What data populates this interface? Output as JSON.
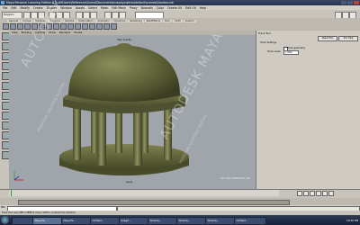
{
  "window": {
    "title": "Maya Personal Learning Edition 8.5: C:\\Users\\Reference\\Guest\\Documents\\maya\\projects\\default\\scenes\\Gazebo.mb"
  },
  "menubar": [
    "File",
    "Edit",
    "Modify",
    "Create",
    "Display",
    "Window",
    "Assets",
    "Select",
    "Mesh",
    "Edit Mesh",
    "Proxy",
    "Normals",
    "Color",
    "Create UV",
    "Edit UV",
    "Help"
  ],
  "statusline": {
    "mode_label": "Polygons"
  },
  "shelf": {
    "tabs": [
      "General",
      "Curves",
      "Surfaces",
      "Polygons",
      "Subdivs",
      "Deformation",
      "Animation",
      "Dynamics",
      "Rendering",
      "PaintEffects",
      "Toon",
      "Cloth",
      "Custom"
    ]
  },
  "viewport": {
    "menu": [
      "View",
      "Shading",
      "Lighting",
      "Show",
      "Renderer",
      "Panels"
    ],
    "panel_label": "High Quality",
    "camera_label": "persp",
    "watermark_1": "AUTODESK MAYA",
    "watermark_2": "AUTODESK MAYA",
    "watermark_small_1": "PERSONAL LEARNING EDITION",
    "watermark_small_2": "PERSONAL LEARNING EDITION",
    "nfc_text": "NOT FOR COMMERCIAL USE"
  },
  "attribute_panel": {
    "header": "Track Tool",
    "reset_button": "Reset Tool",
    "help_button": "Tool Help",
    "section": "Track Settings",
    "geometry_label": "Track geometry",
    "scale_label": "Track scale:",
    "scale_value": "1.0000"
  },
  "timeline": {
    "start": "1.00",
    "end": "24.00"
  },
  "cmdline": {
    "label": "MEL"
  },
  "helpline": {
    "text": "Track Tool: Use LMB or MMB to move. Shift to constrain the direction."
  },
  "taskbar": {
    "tasks": [
      "",
      "Maya Pe...",
      "Maya Pe...",
      "Untitled...",
      "Snagit ...",
      "Window...",
      "Window...",
      "Window...",
      "Untitled ..."
    ],
    "clock": "10:30 PM"
  }
}
